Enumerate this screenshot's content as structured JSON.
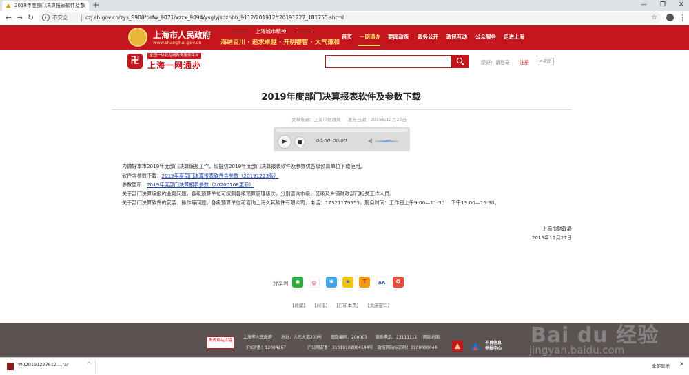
{
  "browser": {
    "tab_title": "2019年度部门决算报表软件及参",
    "new_tab": "+",
    "security_label": "不安全",
    "url": "czj.sh.gov.cn/zys_8908/bsfw_9071/xzzx_9094/ysglyjsbzhbb_9112/201912/t20191227_181755.shtml"
  },
  "site_header": {
    "site_name": "上海市人民政府",
    "domain": "www.shanghai.gov.cn",
    "slogan_top": "上海城市精神",
    "slogan": "海纳百川 · 追求卓越 · 开明睿智 · 大气谦和",
    "nav": [
      "首页",
      "一网通办",
      "要闻动态",
      "政务公开",
      "政民互动",
      "公众服务",
      "走进上海"
    ],
    "active_nav_index": 1,
    "brand_color": "#c4161c"
  },
  "sub_header": {
    "portal_tag": "全国一体化在线政务服务平台",
    "portal_name": "上海一网通办",
    "search_placeholder": "",
    "greeting": "您好！请登录",
    "register": "注册",
    "back": "返回"
  },
  "article": {
    "title": "2019年度部门决算报表软件及参数下载",
    "source": "文章来源：上海市财政局",
    "date": "发布日期：2019年12月27日",
    "player": {
      "current_time": "00:00",
      "duration": "00:00"
    },
    "intro": "为做好本市2019年度部门决算编报工作，现提供2019年度部门决算报表软件及参数供各级预算单位下载使用。",
    "software_label": "软件含参数下载：",
    "software_link": "2019年度部门决算报表软件含参数（20191223版）",
    "param_label": "参数更新：",
    "param_link": "2019年度部门决算报表参数（20200108更新）",
    "line_business": "关于部门决算编报的业务问题，各级预算单位可按照各级预算管理级次，分别咨询市级、区级及乡镇财政部门相关工作人员。",
    "line_support": "关于部门决算软件的安装、操作等问题，各级预算单位可咨询上海久其软件有限公司，电话：17321179553，服务时间：工作日上午9:00—11:30　 下午13:00—16:30。",
    "signature": "上海市财政局",
    "signature_date": "2019年12月27日"
  },
  "share": {
    "label": "分享到",
    "icons": [
      "wechat-icon",
      "weibo-icon",
      "qzone-icon",
      "favorite-icon",
      "tencent-weibo-icon",
      "renren-icon",
      "people-icon"
    ]
  },
  "tools": [
    "【收藏】",
    "【纠错】",
    "【打印本页】",
    "【关闭窗口】"
  ],
  "footer": {
    "org": "上海市人民政府",
    "address": "地址：人民大道200号",
    "postcode": "邮政编码：200003",
    "phone": "联系电话：23111111",
    "sitemap": "网站地图",
    "icp": "沪ICP备：12004267",
    "police": "沪公网安备：31010102004544号",
    "gov_code": "政府网站标识码：3100000044",
    "badge": "政府网站找错",
    "report": "不良信息\n举报中心"
  },
  "download_bar": {
    "file_name": "W020191227612....rar",
    "show_all": "全部显示"
  },
  "watermark": {
    "brand": "Bai du 经验",
    "url": "jingyan.baidu.com"
  }
}
